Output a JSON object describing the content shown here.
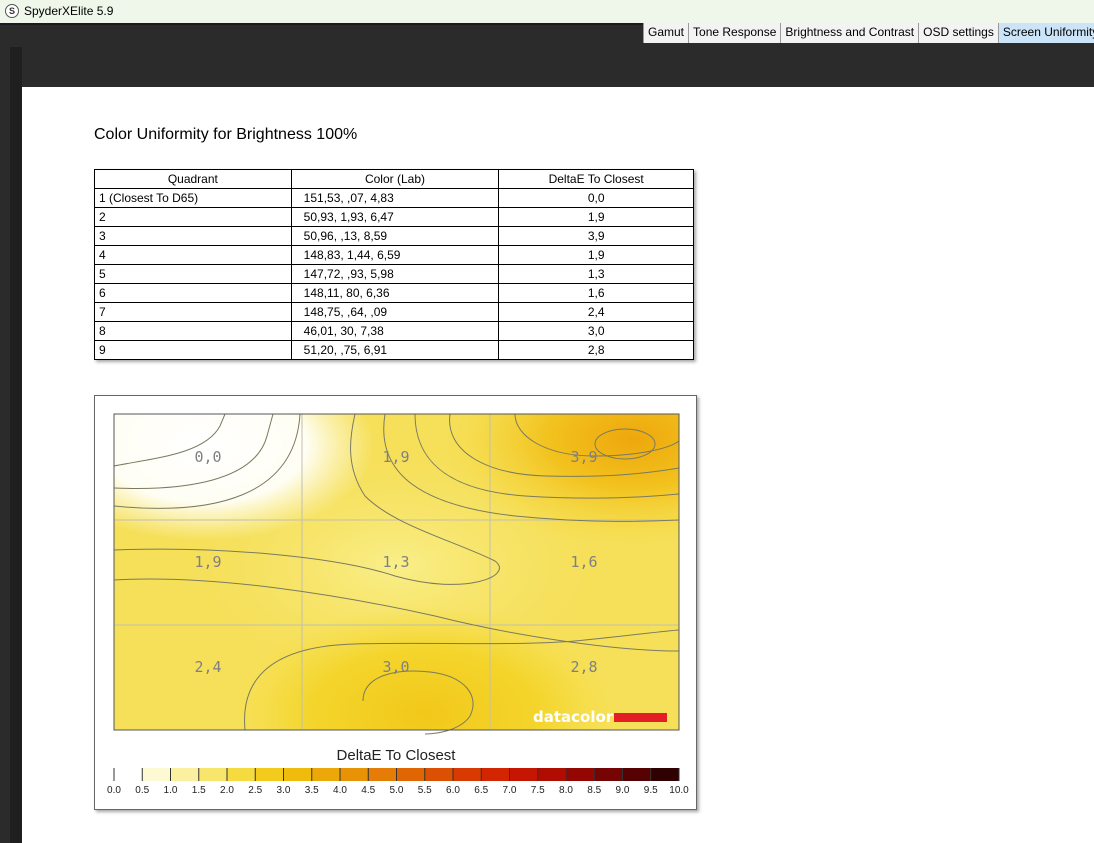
{
  "app": {
    "title": "SpyderXElite 5.9",
    "logo_letter": "S"
  },
  "tabs": [
    {
      "label": "Gamut",
      "active": false
    },
    {
      "label": "Tone Response",
      "active": false
    },
    {
      "label": "Brightness and Contrast",
      "active": false
    },
    {
      "label": "OSD settings",
      "active": false
    },
    {
      "label": "Screen Uniformity",
      "active": true
    }
  ],
  "report": {
    "title": "Color Uniformity for Brightness 100%",
    "table": {
      "headers": [
        "Quadrant",
        "Color (Lab)",
        "DeltaE To Closest"
      ],
      "rows": [
        [
          "1 (Closest To D65)",
          "151,53,    ,07,   4,83",
          "0,0"
        ],
        [
          "2",
          "50,93,   1,93,   6,47",
          "1,9"
        ],
        [
          "3",
          "50,96,    ,13,   8,59",
          "3,9"
        ],
        [
          "4",
          "148,83,   1,44,   6,59",
          "1,9"
        ],
        [
          "5",
          "147,72,    ,93,   5,98",
          "1,3"
        ],
        [
          "6",
          "148,11,     80,   6,36",
          "1,6"
        ],
        [
          "7",
          "148,75,    ,64,    ,09",
          "2,4"
        ],
        [
          "8",
          "46,01,     30,   7,38",
          "3,0"
        ],
        [
          "9",
          "51,20,    ,75,   6,91",
          "2,8"
        ]
      ]
    }
  },
  "chart_data": {
    "type": "heatmap",
    "grid": {
      "rows": 3,
      "cols": 3
    },
    "cells": [
      [
        "0,0",
        "1,9",
        "3,9"
      ],
      [
        "1,9",
        "1,3",
        "1,6"
      ],
      [
        "2,4",
        "3,0",
        "2,8"
      ]
    ],
    "values": [
      [
        0.0,
        1.9,
        3.9
      ],
      [
        1.9,
        1.3,
        1.6
      ],
      [
        2.4,
        3.0,
        2.8
      ]
    ],
    "legend": {
      "title": "DeltaE To Closest",
      "ticks": [
        "0.0",
        "0.5",
        "1.0",
        "1.5",
        "2.0",
        "2.5",
        "3.0",
        "3.5",
        "4.0",
        "4.5",
        "5.0",
        "5.5",
        "6.0",
        "6.5",
        "7.0",
        "7.5",
        "8.0",
        "8.5",
        "9.0",
        "9.5",
        "10.0"
      ],
      "range": [
        0,
        10
      ],
      "colors": [
        "#ffffff",
        "#fdf9d2",
        "#fbf0a0",
        "#f8e56b",
        "#f5da40",
        "#f2cb1c",
        "#efbb0c",
        "#eca808",
        "#e89206",
        "#e47c05",
        "#e06604",
        "#dc5003",
        "#d83a02",
        "#d22602",
        "#c41602",
        "#b00c02",
        "#940602",
        "#760402",
        "#560202",
        "#300101",
        "#000000"
      ]
    },
    "logo": "datacolor",
    "logo_bar_color": "#e31e24"
  }
}
